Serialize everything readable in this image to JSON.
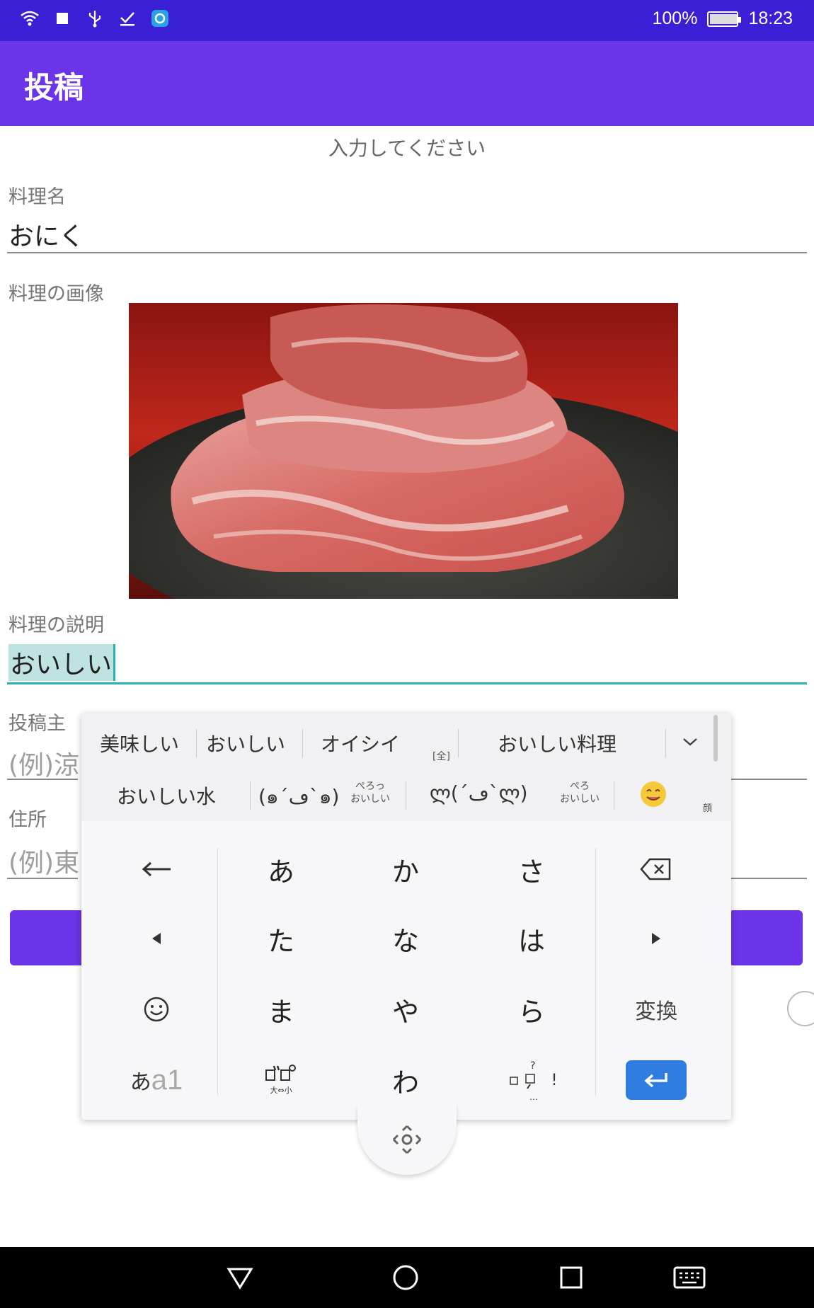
{
  "status_bar": {
    "battery": "100%",
    "time": "18:23",
    "left_icons": [
      "wifi-icon",
      "square-icon",
      "usb-icon",
      "download-done-icon",
      "app-notification-icon"
    ]
  },
  "app_bar": {
    "title": "投稿"
  },
  "form": {
    "instruction": "入力してください",
    "dish_name": {
      "label": "料理名",
      "value": "おにく"
    },
    "dish_image": {
      "label": "料理の画像"
    },
    "description": {
      "label": "料理の説明",
      "value": "おいしい"
    },
    "poster": {
      "label": "投稿主",
      "placeholder": "(例)涼"
    },
    "address": {
      "label": "住所",
      "placeholder": "(例)東"
    }
  },
  "keyboard": {
    "candidates_row1": [
      "美味しい",
      "おいしい",
      "オイシイ",
      "[全]",
      "おいしい料理"
    ],
    "candidates_row2": [
      "おいしい水",
      "(๑´ڡ`๑)",
      "ぺろっ",
      "おいしい",
      "ლ(´ڡ`ლ)",
      "ぺろ",
      "おいしい",
      "顔"
    ],
    "keys": {
      "row1": [
        "あ",
        "か",
        "さ"
      ],
      "row2": [
        "た",
        "な",
        "は"
      ],
      "row3": [
        "ま",
        "や",
        "ら"
      ],
      "row4": [
        "わ"
      ],
      "convert": "変換",
      "mode_kana": "あ",
      "mode_alpha": "a1",
      "dakuten_small": "大⇔小",
      "punct_symbols": "!"
    }
  },
  "colors": {
    "status_bar": "#3a1fd4",
    "app_bar": "#6b34e8",
    "accent_teal": "#26b5b0",
    "enter_key": "#2f7de1"
  }
}
